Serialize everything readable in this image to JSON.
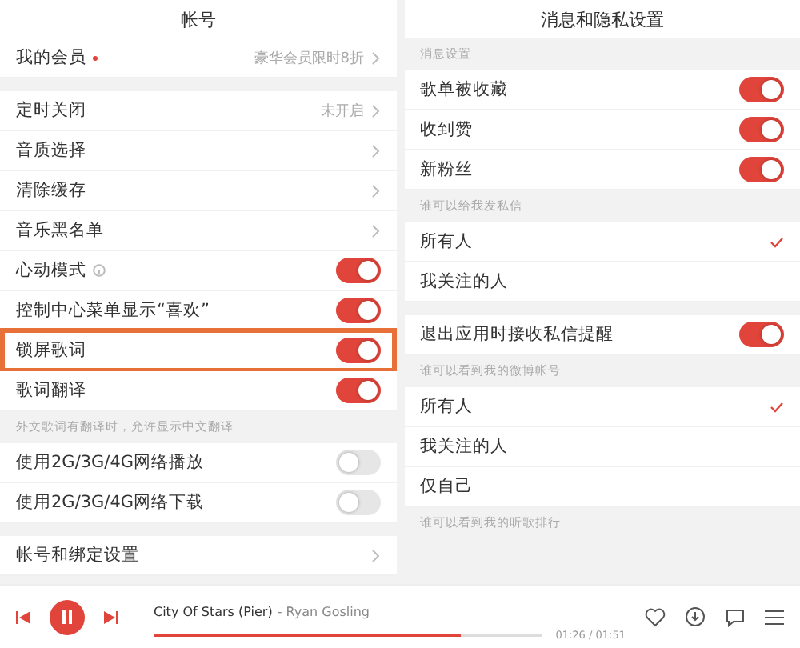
{
  "left_panel": {
    "title": "帐号",
    "member": {
      "label": "我的会员",
      "badge_dot": true,
      "value": "豪华会员限时8折"
    },
    "items": [
      {
        "kind": "link",
        "label": "定时关闭",
        "value": "未开启"
      },
      {
        "kind": "link",
        "label": "音质选择"
      },
      {
        "kind": "link",
        "label": "清除缓存"
      },
      {
        "kind": "link",
        "label": "音乐黑名单"
      },
      {
        "kind": "toggle",
        "label": "心动模式",
        "info": true,
        "on": true
      },
      {
        "kind": "toggle",
        "label": "控制中心菜单显示“喜欢”",
        "on": true
      },
      {
        "kind": "toggle",
        "label": "锁屏歌词",
        "on": true,
        "highlighted": true
      },
      {
        "kind": "toggle",
        "label": "歌词翻译",
        "on": true
      },
      {
        "kind": "hint",
        "label": "外文歌词有翻译时，允许显示中文翻译"
      },
      {
        "kind": "toggle",
        "label": "使用2G/3G/4G网络播放",
        "on": false
      },
      {
        "kind": "toggle",
        "label": "使用2G/3G/4G网络下载",
        "on": false
      },
      {
        "kind": "gap"
      },
      {
        "kind": "link",
        "label": "帐号和绑定设置"
      }
    ]
  },
  "right_panel": {
    "title": "消息和隐私设置",
    "items": [
      {
        "kind": "hint",
        "label": "消息设置"
      },
      {
        "kind": "toggle",
        "label": "歌单被收藏",
        "on": true
      },
      {
        "kind": "toggle",
        "label": "收到赞",
        "on": true
      },
      {
        "kind": "toggle",
        "label": "新粉丝",
        "on": true
      },
      {
        "kind": "hint",
        "label": "谁可以给我发私信"
      },
      {
        "kind": "choice",
        "label": "所有人",
        "selected": true
      },
      {
        "kind": "choice",
        "label": "我关注的人",
        "selected": false
      },
      {
        "kind": "gap"
      },
      {
        "kind": "toggle",
        "label": "退出应用时接收私信提醒",
        "on": true
      },
      {
        "kind": "hint",
        "label": "谁可以看到我的微博帐号"
      },
      {
        "kind": "choice",
        "label": "所有人",
        "selected": true
      },
      {
        "kind": "choice",
        "label": "我关注的人",
        "selected": false
      },
      {
        "kind": "choice",
        "label": "仅自己",
        "selected": false
      },
      {
        "kind": "hint",
        "label": "谁可以看到我的听歌排行"
      }
    ]
  },
  "player": {
    "title": "City Of Stars (Pier)",
    "artist": "- Ryan Gosling",
    "playing": true,
    "level": 0.79,
    "time": "01:26 / 01:51"
  }
}
